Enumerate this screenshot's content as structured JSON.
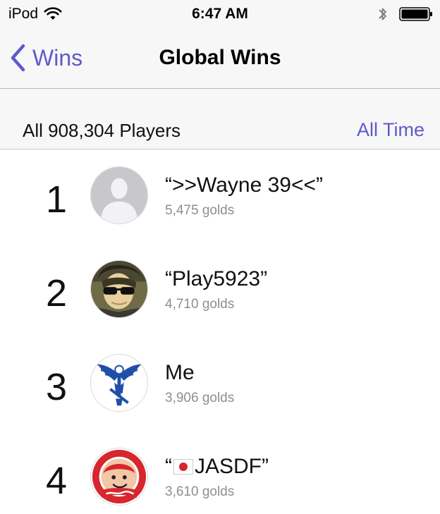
{
  "status_bar": {
    "carrier": "iPod",
    "time": "6:47 AM",
    "icons": [
      "wifi-icon",
      "bluetooth-icon",
      "battery-icon"
    ]
  },
  "nav": {
    "back_label": "Wins",
    "title": "Global Wins"
  },
  "filter": {
    "player_count": "All 908,304 Players",
    "time_range": "All Time"
  },
  "leaderboard": [
    {
      "rank": "1",
      "name": "“>>Wayne 39<<”",
      "score": "5,475 golds",
      "avatar": "placeholder-avatar"
    },
    {
      "rank": "2",
      "name": "“Play5923”",
      "score": "4,710 golds",
      "avatar": "sunglasses-photo-avatar"
    },
    {
      "rank": "3",
      "name": "Me",
      "score": "3,906 golds",
      "avatar": "winged-emblem-avatar"
    },
    {
      "rank": "4",
      "name_prefix": "“",
      "name_suffix": "JASDF”",
      "score": "3,610 golds",
      "avatar": "carp-logo-avatar",
      "flag": "japan-flag-icon"
    }
  ],
  "colors": {
    "accent": "#5f5acb",
    "secondary_text": "#8e8e93",
    "bar_background": "#f7f7f8"
  }
}
